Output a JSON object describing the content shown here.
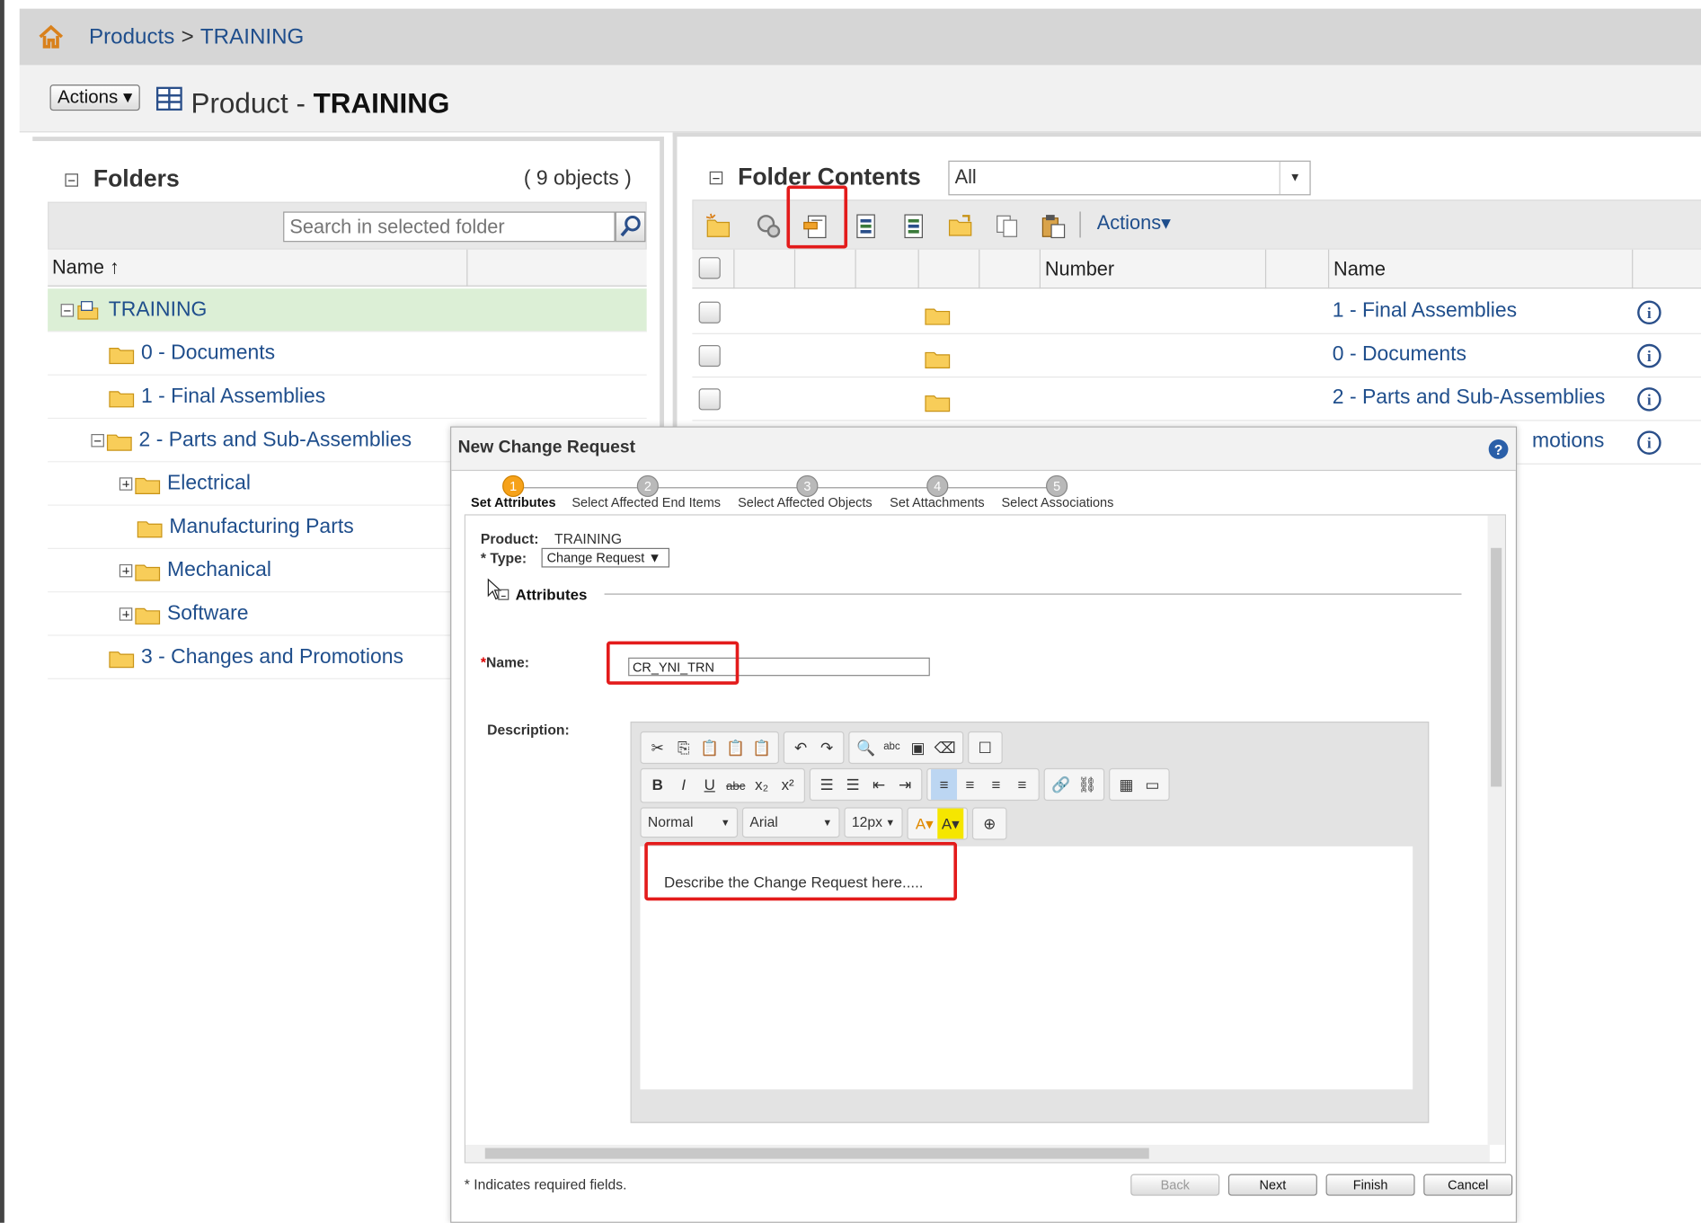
{
  "breadcrumb": {
    "root": "Products",
    "separator": ">",
    "current": "TRAINING"
  },
  "header": {
    "actions_label": "Actions",
    "title_prefix": "Product - ",
    "title_name": "TRAINING"
  },
  "folders_panel": {
    "title": "Folders",
    "count": "( 9 objects )",
    "search_placeholder": "Search in selected folder",
    "column_name": "Name",
    "sort_indicator": "↑",
    "items": [
      {
        "label": "TRAINING"
      },
      {
        "label": "0 - Documents"
      },
      {
        "label": "1 - Final Assemblies"
      },
      {
        "label": "2 - Parts and Sub-Assemblies"
      },
      {
        "label": "Electrical"
      },
      {
        "label": "Manufacturing Parts"
      },
      {
        "label": "Mechanical"
      },
      {
        "label": "Software"
      },
      {
        "label": "3 - Changes and Promotions"
      }
    ]
  },
  "contents_panel": {
    "title": "Folder Contents",
    "filter": "All",
    "actions_label": "Actions",
    "columns": {
      "number": "Number",
      "name": "Name"
    },
    "rows": [
      {
        "name": "1 - Final Assemblies"
      },
      {
        "name": "0 - Documents"
      },
      {
        "name": "2 - Parts and Sub-Assemblies"
      },
      {
        "name": "motions"
      }
    ]
  },
  "dialog": {
    "title": "New Change Request",
    "steps": [
      {
        "num": "1",
        "label": "Set Attributes"
      },
      {
        "num": "2",
        "label": "Select Affected End Items"
      },
      {
        "num": "3",
        "label": "Select Affected Objects"
      },
      {
        "num": "4",
        "label": "Set Attachments"
      },
      {
        "num": "5",
        "label": "Select Associations"
      }
    ],
    "product_label": "Product:",
    "product_value": "TRAINING",
    "type_label": "* Type:",
    "type_value": "Change Request",
    "attributes_label": "Attributes",
    "name_label": "Name:",
    "name_value": "CR_YNI_TRN",
    "description_label": "Description:",
    "editor": {
      "format": "Normal",
      "font": "Arial",
      "size": "12px",
      "body_text": "Describe the Change Request here....."
    },
    "footnote": "* Indicates required fields.",
    "buttons": {
      "back": "Back",
      "next": "Next",
      "finish": "Finish",
      "cancel": "Cancel"
    }
  },
  "colors": {
    "link": "#1f4e8c",
    "highlight": "#e31b1b",
    "selected_row": "#dcefd6",
    "active_step": "#f6a21a"
  }
}
